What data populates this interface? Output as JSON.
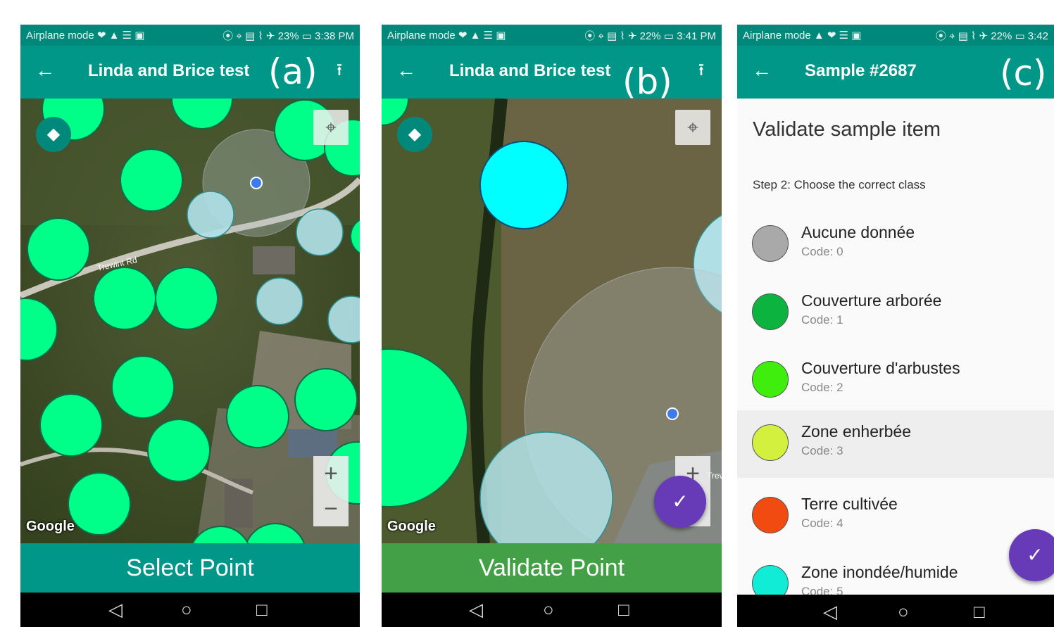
{
  "status": {
    "a": {
      "left": "Airplane mode ❤ ▲ ☰ ▣",
      "right": "⦿ ⌖ ▤ ⌇ ✈ 23% ▭ 3:38 PM"
    },
    "b": {
      "left": "Airplane mode ❤ ▲ ☰ ▣",
      "right": "⦿ ⌖ ▤ ⌇ ✈ 22% ▭ 3:41 PM"
    },
    "c": {
      "left": "Airplane mode ▲ ❤ ☰ ▣",
      "right": "⦿ ⌖ ▤ ⌇ ✈ 22% ▭ 3:42"
    }
  },
  "labels": {
    "a": "(a)",
    "b": "(b)",
    "c": "(c)"
  },
  "panel_a": {
    "title": "Linda and Brice test",
    "action": "Select Point",
    "road": "Trewint Rd",
    "attribution": "Google"
  },
  "panel_b": {
    "title": "Linda and Brice test",
    "action": "Validate Point",
    "road": "Trev",
    "attribution": "Google"
  },
  "panel_c": {
    "title": "Sample #2687",
    "heading": "Validate sample item",
    "step": "Step 2: Choose the correct class",
    "classes": [
      {
        "name": "Aucune donnée",
        "code": "Code: 0",
        "color": "#a9a9a9"
      },
      {
        "name": "Couverture arborée",
        "code": "Code: 1",
        "color": "#0db33f"
      },
      {
        "name": "Couverture d'arbustes",
        "code": "Code: 2",
        "color": "#3fee0d"
      },
      {
        "name": "Zone enherbée",
        "code": "Code: 3",
        "color": "#d4f03e",
        "selected": true
      },
      {
        "name": "Terre cultivée",
        "code": "Code: 4",
        "color": "#f24b12"
      },
      {
        "name": "Zone inondée/humide",
        "code": "Code: 5",
        "color": "#11ecd6"
      }
    ]
  },
  "icons": {
    "back": "←",
    "upload": "⭱",
    "layers": "◆",
    "locate": "⌖",
    "zoom_in": "+",
    "zoom_out": "−",
    "check": "✓",
    "nav_back": "◁",
    "nav_home": "○",
    "nav_recent": "□"
  },
  "colors": {
    "statusbar": "#00897b",
    "appbar": "#009688",
    "select_action": "#009688",
    "validate_action": "#43a047",
    "fab": "#673ab7",
    "sample_point": "#00ff88",
    "validated_point": "#b0e0e6",
    "selected_point": "#00ffff"
  }
}
